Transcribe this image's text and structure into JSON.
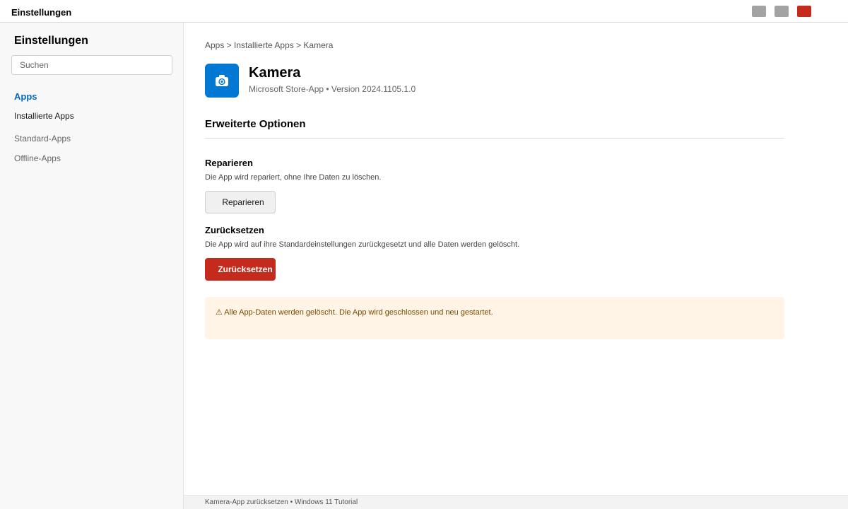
{
  "window": {
    "title": "Einstellungen",
    "colors": {
      "close": "#c42b1c",
      "control": "#a3a3a3"
    }
  },
  "sidebar": {
    "title": "Einstellungen",
    "search_placeholder": "Suchen",
    "items": [
      {
        "label": "Apps",
        "active": true
      },
      {
        "label": "Installierte Apps"
      },
      {
        "label": "Standard-Apps"
      },
      {
        "label": "Offline-Apps"
      }
    ],
    "accent": "#0067c0"
  },
  "main": {
    "breadcrumb": "Apps > Installierte Apps > Kamera",
    "app": {
      "name": "Kamera",
      "meta": "Microsoft Store-App • Version 2024.1105.1.0",
      "icon": "camera-icon",
      "icon_color": "#0078d4"
    },
    "section_title": "Erweiterte Optionen",
    "repair": {
      "title": "Reparieren",
      "description": "Die App wird repariert, ohne Ihre Daten zu löschen.",
      "button": "Reparieren"
    },
    "reset": {
      "title": "Zurücksetzen",
      "description": "Die App wird auf ihre Standardeinstellungen zurückgesetzt und alle Daten werden gelöscht.",
      "button": "Zurücksetzen",
      "button_color": "#c42b1c"
    },
    "warning": {
      "text": "⚠  Alle App-Daten werden gelöscht. Die App wird geschlossen und neu gestartet.",
      "icon": "warning-icon",
      "background": "#fff4e5"
    }
  },
  "footer": {
    "text": "Kamera-App zurücksetzen • Windows 11 Tutorial"
  }
}
